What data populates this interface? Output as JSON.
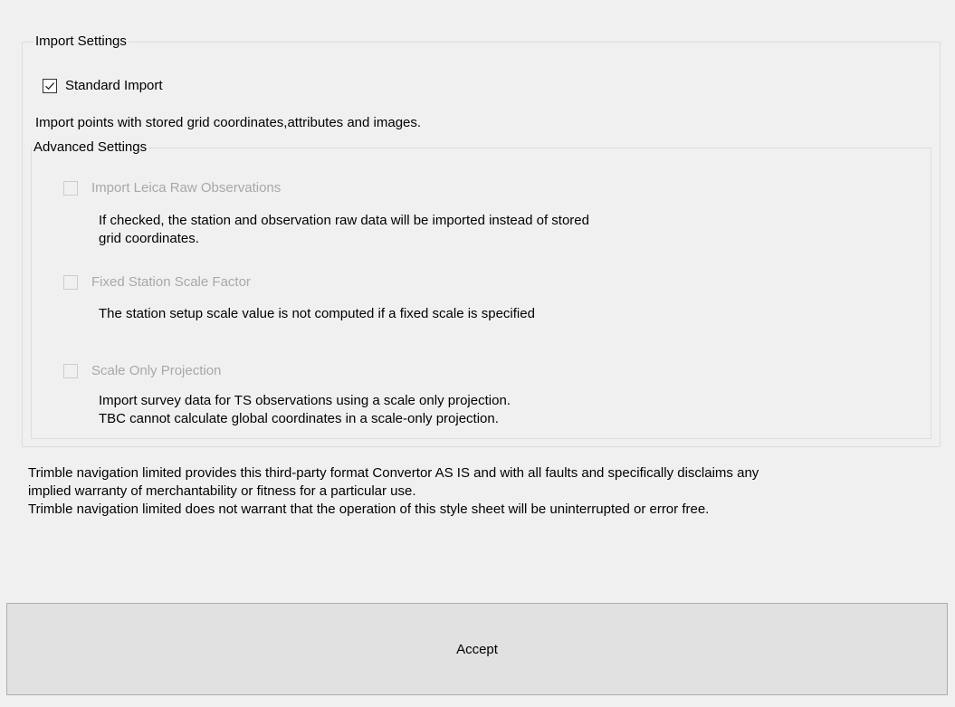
{
  "import_settings": {
    "title": "Import Settings",
    "standard_import": {
      "label": "Standard Import",
      "checked": true,
      "description": "Import points with stored grid coordinates,attributes and images."
    }
  },
  "advanced_settings": {
    "title": "Advanced Settings",
    "options": [
      {
        "label": "Import Leica Raw Observations",
        "checked": false,
        "enabled": false,
        "description_lines": [
          "If checked, the station and observation raw data will be imported instead of stored",
          "grid coordinates."
        ]
      },
      {
        "label": "Fixed Station Scale Factor",
        "checked": false,
        "enabled": false,
        "description_lines": [
          "The station setup scale value is not computed if a fixed scale is specified"
        ]
      },
      {
        "label": "Scale Only Projection",
        "checked": false,
        "enabled": false,
        "description_lines": [
          "Import survey data for TS observations using a scale only projection.",
          "TBC cannot calculate global coordinates in a scale-only projection."
        ]
      }
    ]
  },
  "disclaimer": {
    "lines": [
      "Trimble navigation limited provides this third-party format Convertor AS IS and with all faults and specifically disclaims any",
      "implied warranty of merchantability or fitness for a particular use.",
      "Trimble navigation limited does not warrant that the operation of this style sheet will be uninterrupted or error free."
    ]
  },
  "accept_button": {
    "label": "Accept"
  },
  "colors": {
    "background": "#f0f0f0",
    "button_face": "#e1e1e1",
    "disabled_text": "#a8a8a8"
  }
}
